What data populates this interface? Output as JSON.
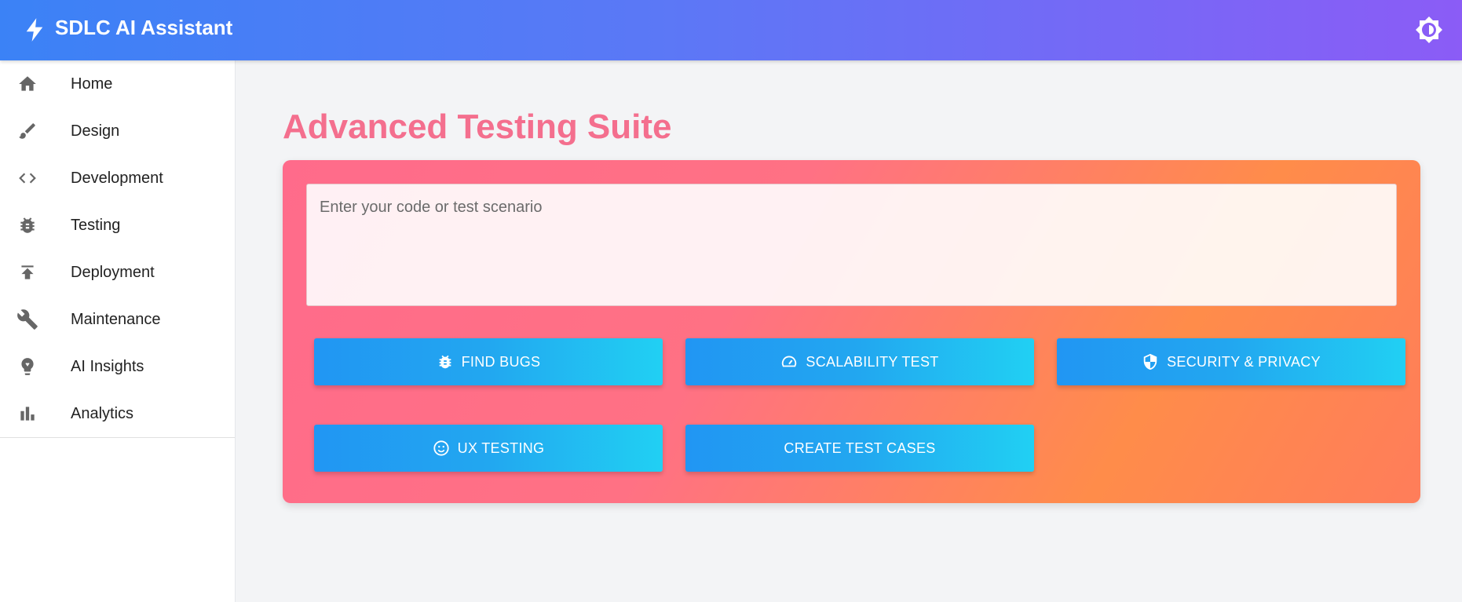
{
  "app": {
    "title": "SDLC AI Assistant",
    "logo_icon": "bolt-icon",
    "theme_toggle_icon": "brightness-icon",
    "header_gradient": [
      "#3b82f6",
      "#8b5cf6"
    ]
  },
  "sidebar": {
    "items": [
      {
        "label": "Home",
        "icon": "home-icon"
      },
      {
        "label": "Design",
        "icon": "brush-icon"
      },
      {
        "label": "Development",
        "icon": "code-icon"
      },
      {
        "label": "Testing",
        "icon": "bug-icon"
      },
      {
        "label": "Deployment",
        "icon": "publish-icon"
      },
      {
        "label": "Maintenance",
        "icon": "wrench-icon"
      },
      {
        "label": "AI Insights",
        "icon": "lightbulb-icon"
      },
      {
        "label": "Analytics",
        "icon": "bar-chart-icon"
      }
    ]
  },
  "main": {
    "title": "Advanced Testing Suite",
    "title_color": "#f46f8e",
    "input": {
      "placeholder": "Enter your code or test scenario",
      "value": ""
    },
    "buttons": [
      {
        "label": "FIND BUGS",
        "icon": "bug-icon"
      },
      {
        "label": "SCALABILITY TEST",
        "icon": "speed-icon"
      },
      {
        "label": "SECURITY & PRIVACY",
        "icon": "shield-icon"
      },
      {
        "label": "UX TESTING",
        "icon": "smiley-icon"
      },
      {
        "label": "CREATE TEST CASES",
        "icon": ""
      }
    ]
  }
}
